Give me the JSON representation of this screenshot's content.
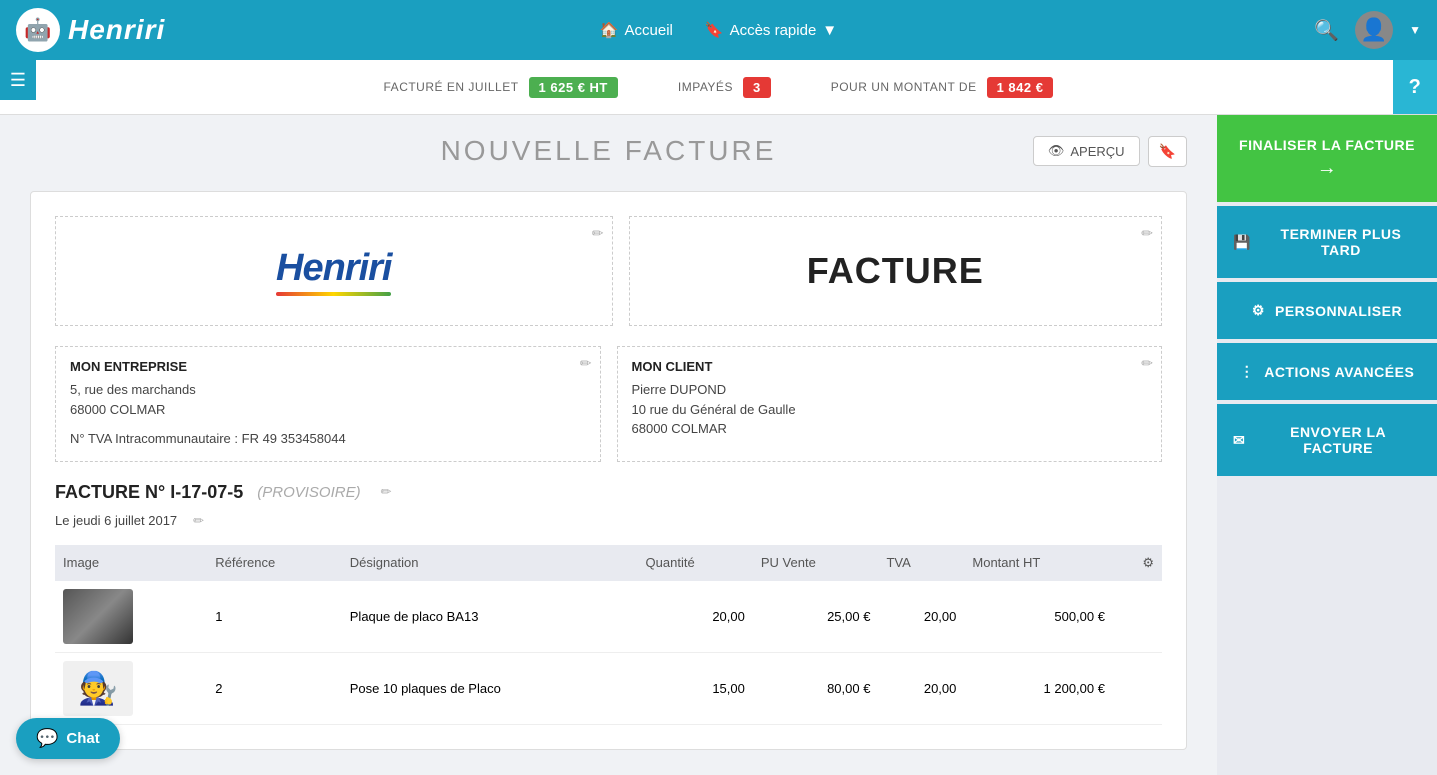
{
  "header": {
    "logo_text": "Henriri",
    "nav_items": [
      {
        "label": "Accueil",
        "icon": "home"
      },
      {
        "label": "Accès rapide",
        "icon": "bookmark",
        "has_dropdown": true
      }
    ],
    "search_icon": "search",
    "avatar_icon": "person"
  },
  "stats_bar": {
    "items": [
      {
        "label": "FACTURÉ EN JUILLET",
        "badge": "1 625 € HT",
        "badge_type": "green"
      },
      {
        "label": "IMPAYÉS",
        "badge": "3",
        "badge_type": "red"
      },
      {
        "label": "POUR UN MONTANT DE",
        "badge": "1 842 €",
        "badge_type": "red"
      }
    ],
    "help_label": "?"
  },
  "page": {
    "title": "NOUVELLE FACTURE",
    "apercu_label": "APERÇU",
    "bookmark_label": "🔖"
  },
  "invoice": {
    "facture_label": "FACTURE",
    "company": {
      "title": "MON ENTREPRISE",
      "address1": "5, rue des marchands",
      "address2": "68000 COLMAR",
      "tva": "N° TVA Intracommunautaire : FR 49 353458044"
    },
    "client": {
      "title": "MON CLIENT",
      "name": "Pierre DUPOND",
      "address1": "10 rue du Général de Gaulle",
      "address2": "68000 COLMAR"
    },
    "number_label": "FACTURE N° I-17-07-5",
    "status_label": "(PROVISOIRE)",
    "date_label": "Le jeudi 6 juillet 2017",
    "table": {
      "headers": [
        "Image",
        "Référence",
        "Désignation",
        "Quantité",
        "PU Vente",
        "TVA",
        "Montant HT"
      ],
      "rows": [
        {
          "img_type": "placo",
          "ref": "1",
          "designation": "Plaque de placo BA13",
          "quantite": "20,00",
          "pu_vente": "25,00 €",
          "tva": "20,00",
          "montant": "500,00 €"
        },
        {
          "img_type": "worker",
          "ref": "2",
          "designation": "Pose 10 plaques de Placo",
          "quantite": "15,00",
          "pu_vente": "80,00 €",
          "tva": "20,00",
          "montant": "1 200,00 €"
        }
      ]
    }
  },
  "right_sidebar": {
    "buttons": [
      {
        "key": "finaliser",
        "label": "FINALISER LA FACTURE",
        "arrow": "→",
        "style": "green",
        "icon": ""
      },
      {
        "key": "terminer",
        "label": "TERMINER PLUS TARD",
        "style": "teal",
        "icon": "💾"
      },
      {
        "key": "personnaliser",
        "label": "PERSONNALISER",
        "style": "teal",
        "icon": "⚙"
      },
      {
        "key": "actions",
        "label": "ACTIONS AVANCÉES",
        "style": "teal",
        "icon": "⋮"
      },
      {
        "key": "envoyer",
        "label": "ENVOYER LA FACTURE",
        "style": "teal",
        "icon": "✉"
      }
    ]
  },
  "chat": {
    "label": "Chat",
    "icon": "💬"
  },
  "sidebar_toggle": {
    "icon": "☰"
  }
}
